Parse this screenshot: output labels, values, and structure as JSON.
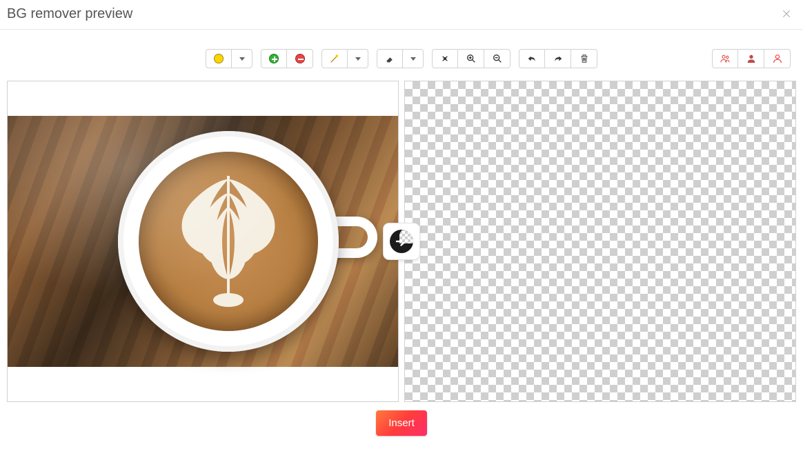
{
  "header": {
    "title": "BG remover preview"
  },
  "toolbar": {
    "mode_dot": "mode-selector",
    "add_mark": "add-marker",
    "remove_mark": "remove-marker",
    "magic_wand": "magic-wand",
    "eraser": "eraser",
    "crosshair": "move-tool",
    "zoom_in": "zoom-in",
    "zoom_out": "zoom-out",
    "undo": "undo",
    "redo": "redo",
    "delete": "delete"
  },
  "right_toolbar": {
    "people": "people-mask",
    "person_solid": "single-person-solid",
    "person_outline": "single-person-outline"
  },
  "panes": {
    "left_alt": "Original image: latte in white cup on wooden table",
    "right_alt": "Transparent background preview"
  },
  "center_arrow": "process-arrow",
  "footer": {
    "insert_label": "Insert"
  }
}
